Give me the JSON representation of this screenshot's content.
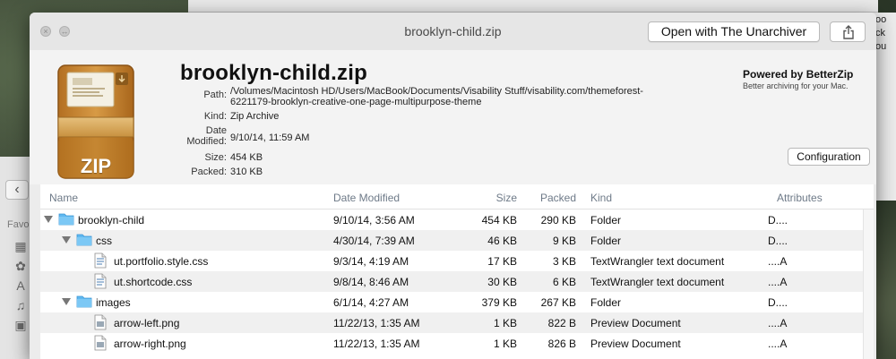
{
  "window": {
    "title": "brooklyn-child.zip",
    "open_button": "Open with The Unarchiver"
  },
  "file": {
    "name": "brooklyn-child.zip",
    "labels": {
      "path": "Path:",
      "kind": "Kind:",
      "date": "Date",
      "modified": "Modified:",
      "size": "Size:",
      "packed": "Packed:"
    },
    "path_line1": "/Volumes/Macintosh HD/Users/MacBook/Documents/Visability Stuff/visability.com/themeforest-",
    "path_line2": "6221179-brooklyn-creative-one-page-multipurpose-theme",
    "kind": "Zip Archive",
    "date_modified": "9/10/14, 11:59 AM",
    "size": "454 KB",
    "packed": "310 KB",
    "icon_label": "ZIP"
  },
  "powered": {
    "title": "Powered by BetterZip",
    "subtitle": "Better archiving for your Mac."
  },
  "config_button": "Configuration",
  "columns": {
    "name": "Name",
    "date": "Date Modified",
    "size": "Size",
    "packed": "Packed",
    "kind": "Kind",
    "attributes": "Attributes"
  },
  "rows": [
    {
      "name": "brooklyn-child",
      "date": "9/10/14, 3:56 AM",
      "size": "454 KB",
      "packed": "290 KB",
      "kind": "Folder",
      "attr": "D....",
      "type": "folder",
      "level": 0,
      "expanded": true
    },
    {
      "name": "css",
      "date": "4/30/14, 7:39 AM",
      "size": "46 KB",
      "packed": "9 KB",
      "kind": "Folder",
      "attr": "D....",
      "type": "folder",
      "level": 1,
      "expanded": true
    },
    {
      "name": "ut.portfolio.style.css",
      "date": "9/3/14, 4:19 AM",
      "size": "17 KB",
      "packed": "3 KB",
      "kind": "TextWrangler text document",
      "attr": "....A",
      "type": "text",
      "level": 2
    },
    {
      "name": "ut.shortcode.css",
      "date": "9/8/14, 8:46 AM",
      "size": "30 KB",
      "packed": "6 KB",
      "kind": "TextWrangler text document",
      "attr": "....A",
      "type": "text",
      "level": 2
    },
    {
      "name": "images",
      "date": "6/1/14, 4:27 AM",
      "size": "379 KB",
      "packed": "267 KB",
      "kind": "Folder",
      "attr": "D....",
      "type": "folder",
      "level": 1,
      "expanded": true
    },
    {
      "name": "arrow-left.png",
      "date": "11/22/13, 1:35 AM",
      "size": "1 KB",
      "packed": "822 B",
      "kind": "Preview Document",
      "attr": "....A",
      "type": "image",
      "level": 2
    },
    {
      "name": "arrow-right.png",
      "date": "11/22/13, 1:35 AM",
      "size": "1 KB",
      "packed": "826 B",
      "kind": "Preview Document",
      "attr": "....A",
      "type": "image",
      "level": 2
    }
  ],
  "background": {
    "right_fragment_1": "oo",
    "right_fragment_2": "ck",
    "right_fragment_3": "ou",
    "finder_label": "Favo"
  }
}
